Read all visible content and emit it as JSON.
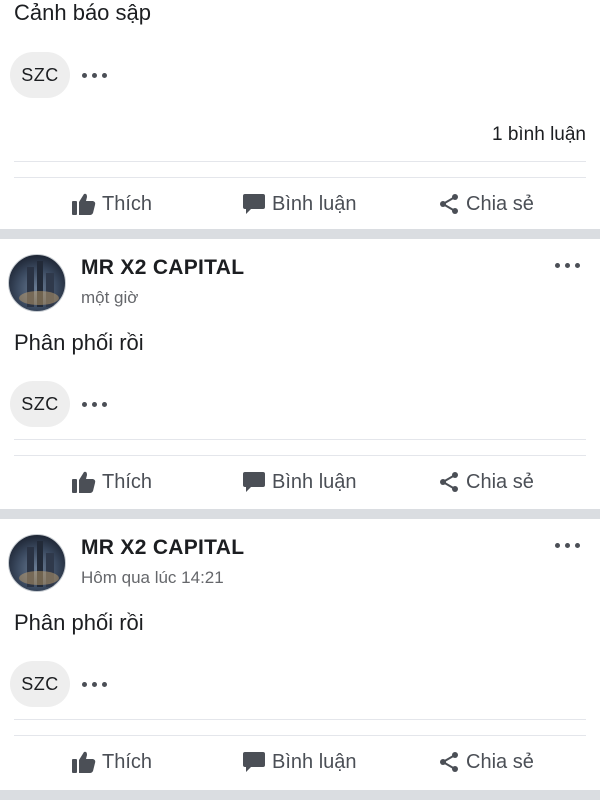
{
  "posts": [
    {
      "text": "Cảnh báo sập",
      "tag": "SZC",
      "comment_count": "1 bình luận",
      "actions": {
        "like": "Thích",
        "comment": "Bình luận",
        "share": "Chia sẻ"
      }
    },
    {
      "author": "MR X2 CAPITAL",
      "time": "một giờ",
      "text": "Phân phối rồi",
      "tag": "SZC",
      "actions": {
        "like": "Thích",
        "comment": "Bình luận",
        "share": "Chia sẻ"
      }
    },
    {
      "author": "MR X2 CAPITAL",
      "time": "Hôm qua lúc 14:21",
      "text": "Phân phối rồi",
      "tag": "SZC",
      "actions": {
        "like": "Thích",
        "comment": "Bình luận",
        "share": "Chia sẻ"
      }
    }
  ],
  "icons": {
    "like": "thumbs-up-icon",
    "comment": "comment-bubble-icon",
    "share": "share-icon",
    "more": "more-horizontal-icon"
  },
  "colors": {
    "separator": "#dadde1",
    "action_text": "#4b4f56",
    "time_text": "#65676b"
  }
}
